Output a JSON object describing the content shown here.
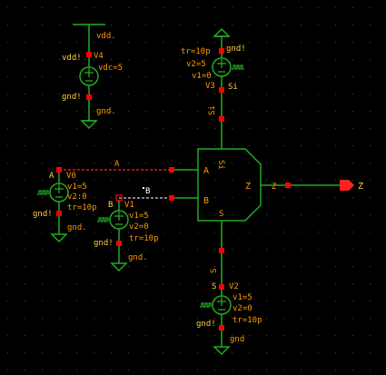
{
  "colors": {
    "background": "#000000",
    "grid": "#3a3a3a",
    "wire": "#22aa22",
    "pin": "#ff0000",
    "label": "#ff9a00",
    "net_label": "#ffd23a",
    "selected": "#ff2222",
    "selected_alt": "#cfcfff",
    "output_arrow": "#ff2222"
  },
  "vdd_source": {
    "net_top": "vdd.",
    "net_left": "vdd!",
    "instance": "V4",
    "param": "vdc=5",
    "net_bottom_left": "gnd!",
    "net_bottom": "gnd."
  },
  "vsi_source": {
    "tr": "tr=10p",
    "v2": "v2=5",
    "v1": "v1=0",
    "instance": "V3",
    "net_top": "gnd!",
    "net_right": "Si",
    "wire_label": "Si"
  },
  "va_source": {
    "pin_label": "A",
    "instance": "V0",
    "v1": "v1=5",
    "v2": "v2:0",
    "tr": "tr=10p",
    "net_bottom": "gnd!",
    "net_bottom2": "gnd.",
    "wire_label": "A"
  },
  "vb_source": {
    "pin_label": "B",
    "instance": "V1",
    "v1": "v1=5",
    "v2": "v2=0",
    "tr": "tr=10p",
    "net_bottom": "gnd!",
    "net_bottom2": "gnd.",
    "wire_label": "B"
  },
  "vs_source": {
    "net_top": "S",
    "pin_label": "S",
    "instance": "V2",
    "v1": "v1=5",
    "v2": "v2=0",
    "tr": "tr=10p",
    "net_bottom": "gnd!",
    "net_bottom2": "gnd"
  },
  "gate": {
    "pin_si": "Si",
    "pin_a": "A",
    "pin_b": "B",
    "pin_s": "S",
    "pin_z": "Z"
  },
  "output": {
    "wire_label": "Z",
    "net_label": "Z"
  }
}
